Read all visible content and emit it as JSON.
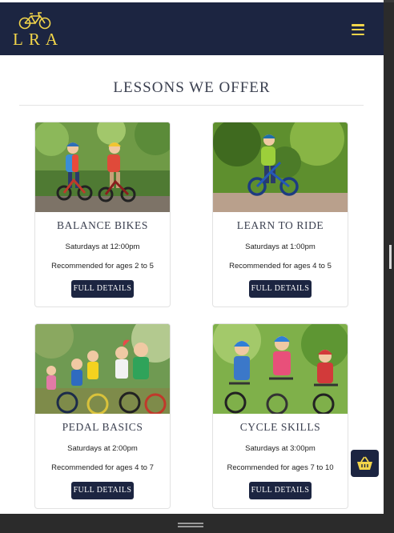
{
  "brand": {
    "logo_text": "LRA"
  },
  "header": {
    "menu_icon": "hamburger-menu-icon"
  },
  "main": {
    "section_title": "LESSONS WE OFFER",
    "lessons": [
      {
        "title": "BALANCE BIKES",
        "schedule": "Saturdays at 12:00pm",
        "ages": "Recommended for ages 2 to 5",
        "button": "FULL DETAILS"
      },
      {
        "title": "LEARN TO RIDE",
        "schedule": "Saturdays at 1:00pm",
        "ages": "Recommended for ages 4 to 5",
        "button": "FULL DETAILS"
      },
      {
        "title": "PEDAL BASICS",
        "schedule": "Saturdays at 2:00pm",
        "ages": "Recommended for ages 4 to 7",
        "button": "FULL DETAILS"
      },
      {
        "title": "CYCLE SKILLS",
        "schedule": "Saturdays at 3:00pm",
        "ages": "Recommended for ages 7 to 10",
        "button": "FULL DETAILS"
      }
    ]
  },
  "floating": {
    "basket_icon": "shopping-basket-icon"
  },
  "colors": {
    "navy": "#1c2541",
    "accent_yellow": "#f2d54a",
    "text_dark": "#3a3f4f"
  }
}
